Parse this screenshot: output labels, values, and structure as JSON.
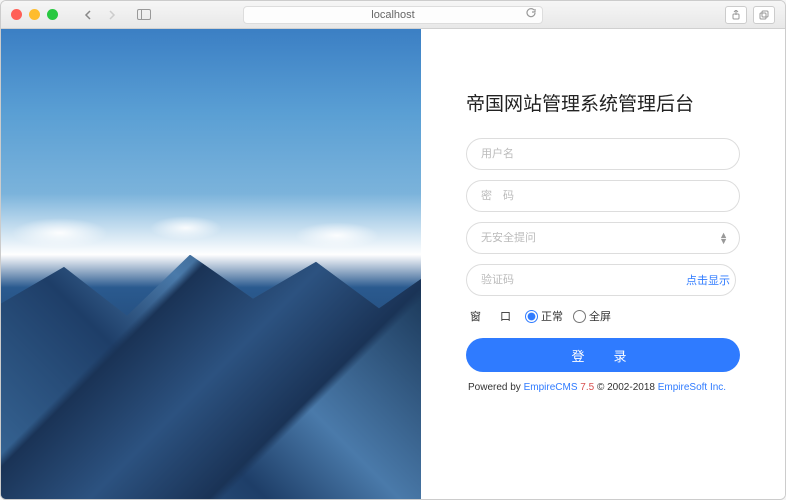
{
  "browser": {
    "address": "localhost"
  },
  "login": {
    "title": "帝国网站管理系统管理后台",
    "username_placeholder": "用户名",
    "password_placeholder": "密　码",
    "security_select": "无安全提问",
    "captcha_placeholder": "验证码",
    "captcha_link": "点击显示",
    "window_label": "窗　口",
    "radio_normal": "正常",
    "radio_fullscreen": "全屏",
    "submit": "登　录"
  },
  "footer": {
    "powered": "Powered by ",
    "product": "EmpireCMS",
    "version": " 7.5 ",
    "copyright": "© 2002-2018 ",
    "company": "EmpireSoft Inc."
  }
}
